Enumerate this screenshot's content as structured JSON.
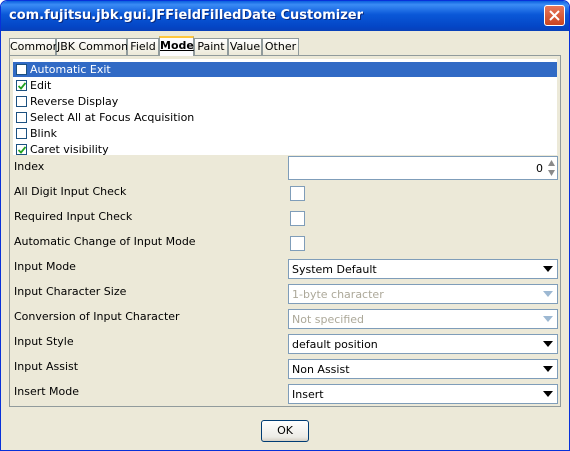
{
  "window": {
    "title": "com.fujitsu.jbk.gui.JFFieldFilledDate Customizer"
  },
  "tabs": [
    {
      "label": "Common"
    },
    {
      "label": "JBK Common"
    },
    {
      "label": "Field"
    },
    {
      "label": "Mode"
    },
    {
      "label": "Paint"
    },
    {
      "label": "Value"
    },
    {
      "label": "Other"
    }
  ],
  "active_tab": "Mode",
  "options": [
    {
      "label": "Automatic Exit",
      "checked": false,
      "selected": true
    },
    {
      "label": "Edit",
      "checked": true,
      "selected": false
    },
    {
      "label": "Reverse Display",
      "checked": false,
      "selected": false
    },
    {
      "label": "Select All at Focus Acquisition",
      "checked": false,
      "selected": false
    },
    {
      "label": "Blink",
      "checked": false,
      "selected": false
    },
    {
      "label": "Caret visibility",
      "checked": true,
      "selected": false
    }
  ],
  "fields": {
    "index": {
      "label": "Index",
      "value": "0"
    },
    "all_digit": {
      "label": "All Digit Input Check",
      "checked": false
    },
    "required": {
      "label": "Required Input Check",
      "checked": false
    },
    "auto_change": {
      "label": "Automatic Change of Input Mode",
      "checked": false
    },
    "input_mode": {
      "label": "Input Mode",
      "value": "System Default"
    },
    "char_size": {
      "label": "Input Character Size",
      "value": "1-byte character",
      "enabled": false
    },
    "conversion": {
      "label": "Conversion of Input Character",
      "value": "Not specified",
      "enabled": false
    },
    "input_style": {
      "label": "Input Style",
      "value": "default position"
    },
    "input_assist": {
      "label": "Input Assist",
      "value": "Non Assist"
    },
    "insert_mode": {
      "label": "Insert Mode",
      "value": "Insert"
    }
  },
  "buttons": {
    "ok": "OK"
  },
  "colors": {
    "title_bar": "#0a58d8",
    "selection": "#316ac5",
    "dialog_bg": "#ece9d8",
    "disabled_text": "#aca899"
  }
}
